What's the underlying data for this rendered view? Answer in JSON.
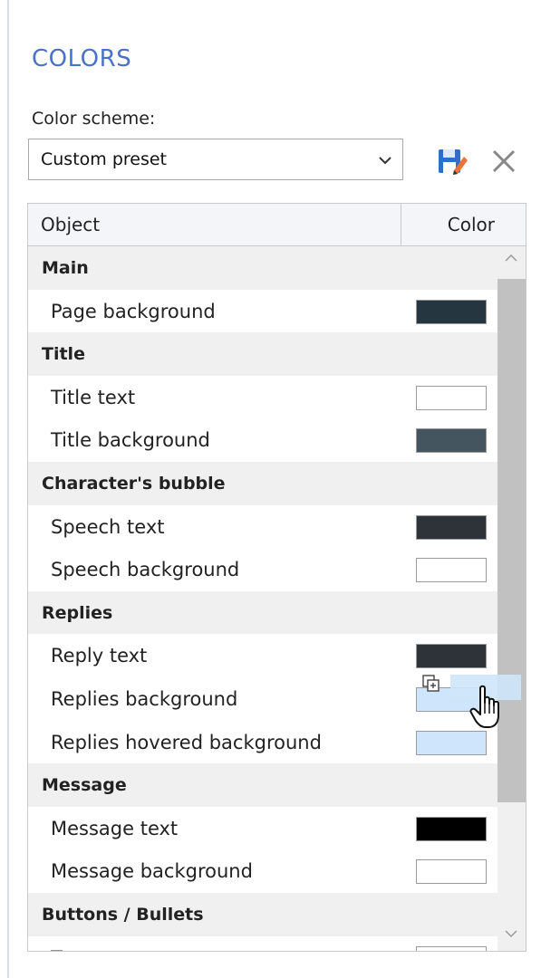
{
  "panel": {
    "title": "COLORS"
  },
  "scheme": {
    "label": "Color scheme:",
    "selected": "Custom preset",
    "save_icon": "save-icon",
    "delete_icon": "close-icon"
  },
  "grid": {
    "headers": {
      "object": "Object",
      "color": "Color"
    },
    "rows": [
      {
        "type": "group",
        "label": "Main"
      },
      {
        "type": "item",
        "label": "Page background",
        "color": "#263640"
      },
      {
        "type": "group",
        "label": "Title"
      },
      {
        "type": "item",
        "label": "Title text",
        "color": "#ffffff"
      },
      {
        "type": "item",
        "label": "Title background",
        "color": "#455560"
      },
      {
        "type": "group",
        "label": "Character's bubble"
      },
      {
        "type": "item",
        "label": "Speech text",
        "color": "#2d3338"
      },
      {
        "type": "item",
        "label": "Speech background",
        "color": "#ffffff"
      },
      {
        "type": "group",
        "label": "Replies"
      },
      {
        "type": "item",
        "label": "Reply text",
        "color": "#2d3338"
      },
      {
        "type": "item",
        "label": "Replies background",
        "color": "#cfe5fb"
      },
      {
        "type": "item",
        "label": "Replies hovered background",
        "color": "#cfe5fb"
      },
      {
        "type": "group",
        "label": "Message"
      },
      {
        "type": "item",
        "label": "Message text",
        "color": "#000000"
      },
      {
        "type": "item",
        "label": "Message background",
        "color": "#ffffff"
      },
      {
        "type": "group",
        "label": "Buttons / Bullets"
      },
      {
        "type": "item",
        "label": "Text",
        "color": "#ffffff"
      }
    ]
  },
  "colors": {
    "accent": "#4a72c9",
    "group_bg": "#f0f0f0",
    "header_bg": "#f3f5f8"
  }
}
